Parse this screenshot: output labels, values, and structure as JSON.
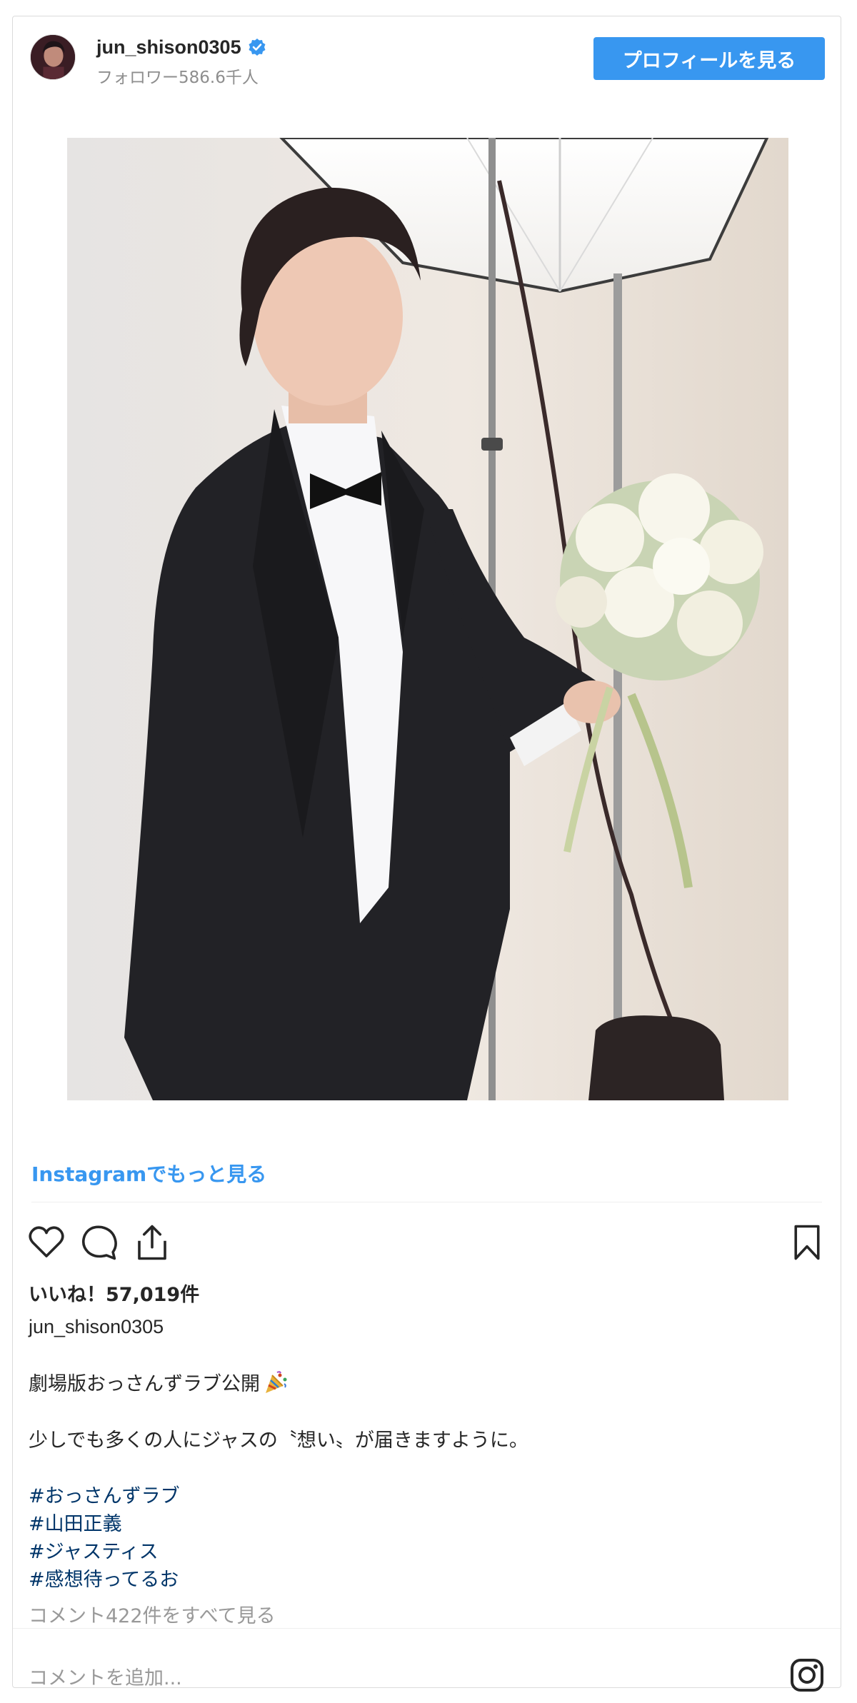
{
  "header": {
    "username": "jun_shison0305",
    "followers": "フォロワー586.6千人",
    "profile_button": "プロフィールを見る"
  },
  "post": {
    "more_link": "Instagramでもっと見る",
    "likes": "いいね！57,019件",
    "caption_user": "jun_shison0305",
    "caption_line1": "劇場版おっさんずラブ公開",
    "caption_line2": "少しでも多くの人にジャスの〝想い〟が届きますように。",
    "hashtags": [
      "#おっさんずラブ",
      "#山田正義",
      "#ジャスティス",
      "#感想待ってるお"
    ],
    "view_comments": "コメント422件をすべて見る",
    "add_comment_placeholder": "コメントを追加..."
  },
  "icons": {
    "verified": "verified-badge-icon",
    "like": "heart-icon",
    "comment": "comment-icon",
    "share": "share-icon",
    "save": "bookmark-icon",
    "instagram": "instagram-logo-icon",
    "party": "party-popper-icon"
  },
  "colors": {
    "accent": "#3897f0",
    "hashtag": "#003569",
    "muted": "#8e8e8e"
  }
}
